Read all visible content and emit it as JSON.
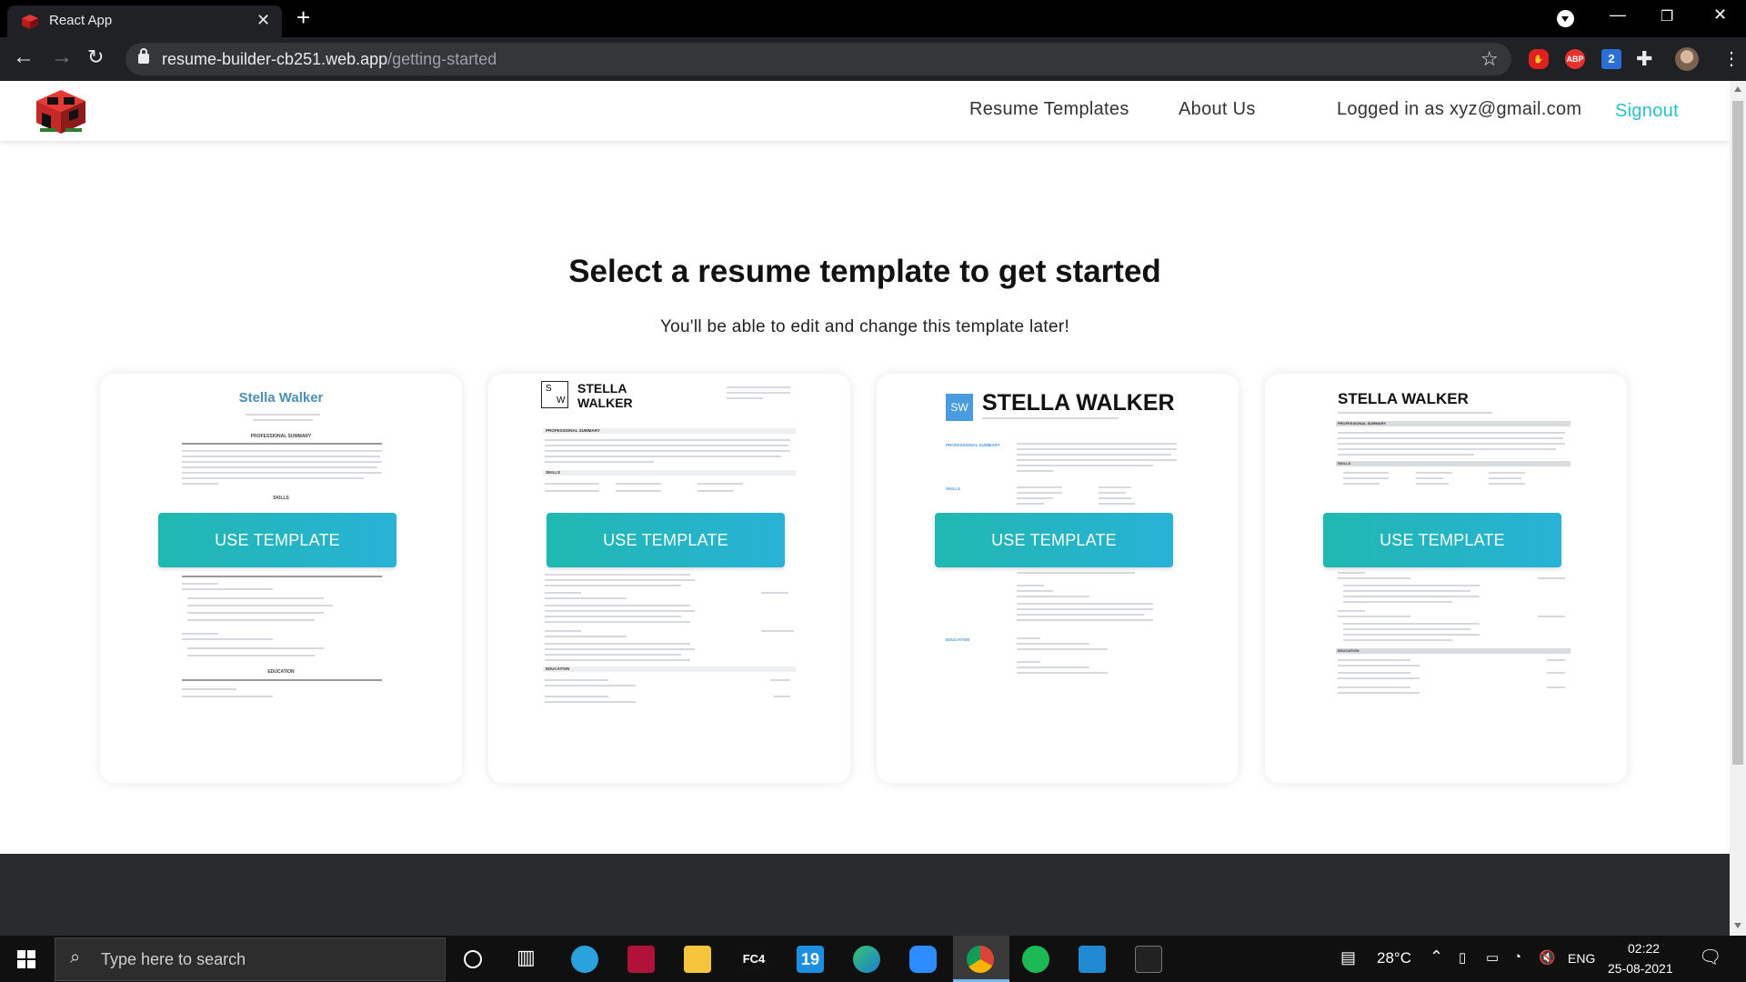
{
  "browser": {
    "tab_title": "React App",
    "url_domain": "resume-builder-cb251.web.app",
    "url_path": "/getting-started",
    "extensions": [
      {
        "name": "adblock-extension-icon",
        "label": "ABP",
        "color": "#e8312f"
      },
      {
        "name": "badge-extension-icon",
        "label": "2",
        "color": "#2b6fd6"
      }
    ]
  },
  "navbar": {
    "links": [
      "Resume Templates",
      "About Us"
    ],
    "logged_in_text": "Logged in as xyz@gmail.com",
    "signout_label": "Signout"
  },
  "main": {
    "title": "Select a resume template to get started",
    "subtitle": "You'll be able to edit and change this template later!",
    "use_template_label": "USE TEMPLATE",
    "templates": [
      {
        "name": "Stella Walker",
        "sections": [
          "PROFESSIONAL SUMMARY",
          "SKILLS",
          "EDUCATION"
        ],
        "accent": "#4a8fb8"
      },
      {
        "name_line1": "STELLA",
        "name_line2": "WALKER",
        "initials_top": "S",
        "initials_bottom": "W",
        "sections": [
          "PROFESSIONAL SUMMARY",
          "SKILLS",
          "EDUCATION"
        ]
      },
      {
        "name": "STELLA WALKER",
        "initials": "SW",
        "sections": [
          "PROFESSIONAL SUMMARY",
          "SKILLS",
          "EDUCATION"
        ],
        "accent": "#4a9be0"
      },
      {
        "name": "STELLA WALKER",
        "sections": [
          "PROFESSIONAL SUMMARY",
          "SKILLS",
          "EDUCATION"
        ]
      }
    ]
  },
  "taskbar": {
    "search_placeholder": "Type here to search",
    "weather": "28°C",
    "language": "ENG",
    "time": "02:22",
    "date": "25-08-2021",
    "apps": [
      "telegram-icon",
      "vivaldi-icon",
      "file-explorer-icon",
      "fc4-icon",
      "nineteen-icon",
      "edge-icon",
      "zoom-icon",
      "chrome-icon",
      "spotify-icon",
      "vscode-icon",
      "terminal-icon"
    ],
    "app_labels": {
      "fc4": "FC4",
      "nineteen": "19"
    }
  }
}
